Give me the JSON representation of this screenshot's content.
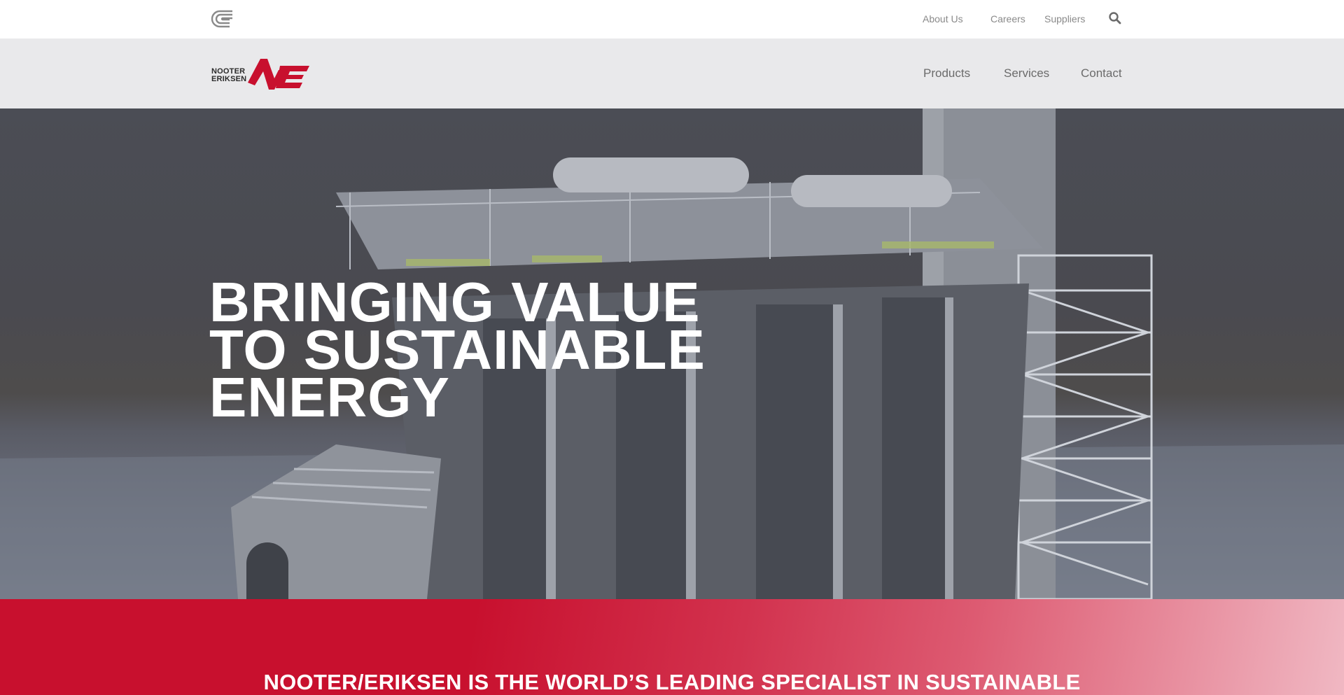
{
  "utility_nav": {
    "about": "About Us",
    "careers": "Careers",
    "suppliers": "Suppliers",
    "search_icon": "search-icon"
  },
  "brand": {
    "line1": "NOOTER",
    "line2": "ERIKSEN",
    "mark": "NE",
    "accent_color": "#c8102e"
  },
  "main_nav": {
    "products": "Products",
    "services": "Services",
    "contact": "Contact"
  },
  "hero": {
    "title_lines": [
      "BRINGING VALUE",
      "TO SUSTAINABLE",
      "ENERGY"
    ]
  },
  "band": {
    "tagline": "NOOTER/ERIKSEN IS THE WORLD’S LEADING SPECIALIST IN SUSTAINABLE"
  }
}
